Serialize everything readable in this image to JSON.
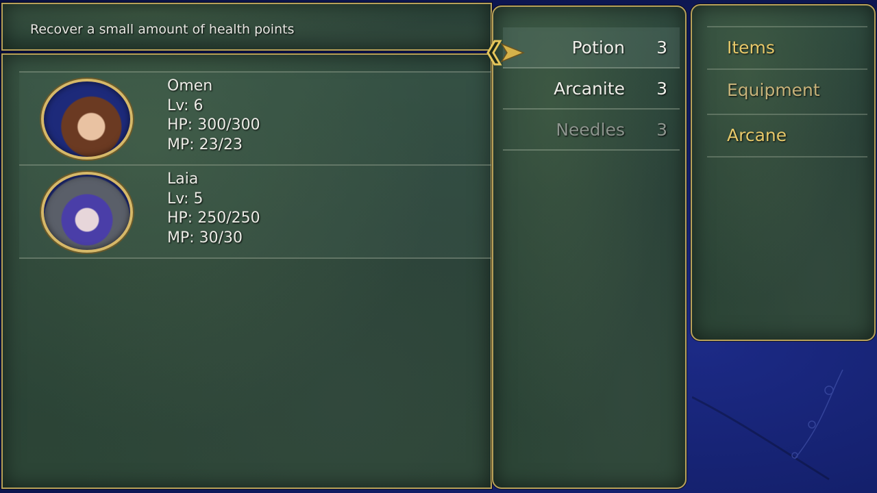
{
  "help": {
    "text": "Recover a small amount of health points"
  },
  "party": [
    {
      "name": "Omen",
      "level": "Lv: 6",
      "hp": "HP: 300/300",
      "mp": "MP: 23/23"
    },
    {
      "name": "Laia",
      "level": "Lv: 5",
      "hp": "HP: 250/250",
      "mp": "MP: 30/30"
    }
  ],
  "items": [
    {
      "name": "Potion",
      "qty": "3"
    },
    {
      "name": "Arcanite",
      "qty": "3"
    },
    {
      "name": "Needles",
      "qty": "3"
    }
  ],
  "categories": [
    "Items",
    "Equipment",
    "Arcane"
  ],
  "colors": {
    "border_gold": "#b9a25a",
    "label_gold": "#e7c96a",
    "panel_green": "#2c4536",
    "bg_blue": "#0f1a5c"
  },
  "icons": {
    "cursor": "selection-arrow-icon"
  }
}
